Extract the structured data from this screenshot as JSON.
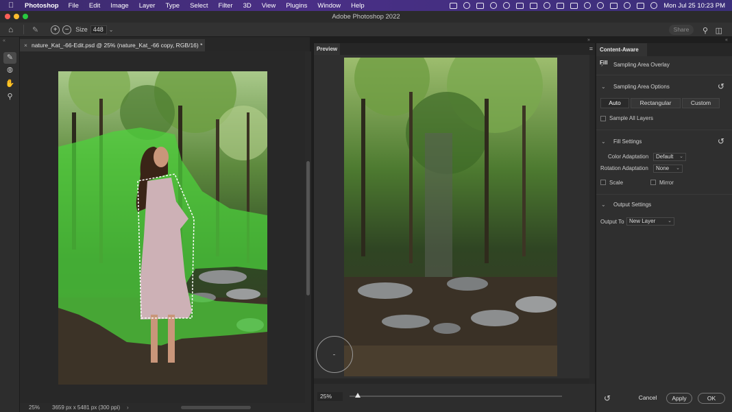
{
  "menubar": {
    "app_name": "Photoshop",
    "items": [
      "File",
      "Edit",
      "Image",
      "Layer",
      "Type",
      "Select",
      "Filter",
      "3D",
      "View",
      "Plugins",
      "Window",
      "Help"
    ],
    "clock": "Mon Jul 25  10:23 PM"
  },
  "window": {
    "title": "Adobe Photoshop 2022"
  },
  "options_bar": {
    "size_label": "Size",
    "size_value": "448",
    "share_label": "Share"
  },
  "document": {
    "tab_title": "nature_Kat_-66-Edit.psd @ 25% (nature_Kat_-66 copy, RGB/16) *",
    "zoom": "25%",
    "dimensions": "3659 px x 5481 px (300 ppi)"
  },
  "preview": {
    "tab_label": "Preview",
    "zoom": "25%",
    "zoom_fraction": 0.04
  },
  "content_aware_fill": {
    "panel_title": "Content-Aware Fill",
    "sections": {
      "sampling_overlay": "Sampling Area Overlay",
      "sampling_options": "Sampling Area Options",
      "fill_settings": "Fill Settings",
      "output_settings": "Output Settings"
    },
    "sampling_modes": [
      "Auto",
      "Rectangular",
      "Custom"
    ],
    "active_mode": "Auto",
    "sample_all_layers_label": "Sample All Layers",
    "color_adaptation_label": "Color Adaptation",
    "color_adaptation_value": "Default",
    "rotation_adaptation_label": "Rotation Adaptation",
    "rotation_adaptation_value": "None",
    "scale_label": "Scale",
    "mirror_label": "Mirror",
    "output_to_label": "Output To",
    "output_to_value": "New Layer",
    "buttons": {
      "cancel": "Cancel",
      "apply": "Apply",
      "ok": "OK"
    }
  },
  "colors": {
    "menubar_purple": "#4a2f86",
    "overlay_green": "#4cd23c",
    "traffic_red": "#fe5f57",
    "traffic_yellow": "#febc2e",
    "traffic_green": "#28c840"
  }
}
